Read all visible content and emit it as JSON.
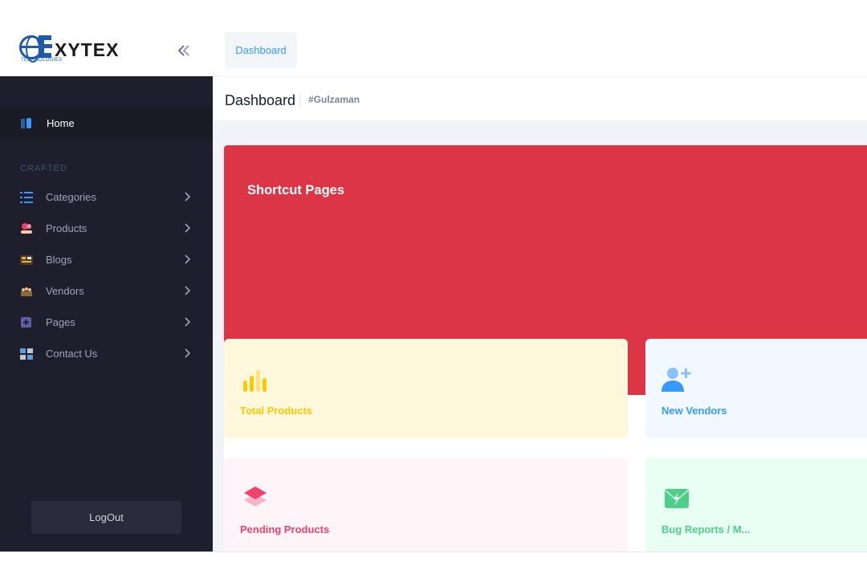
{
  "brand": {
    "logo_text": "XYTEX",
    "logo_subtext": "TECHNOLOGIES"
  },
  "header": {
    "tab_label": "Dashboard"
  },
  "subheader": {
    "title": "Dashboard",
    "user_tag": "#Gulzaman"
  },
  "sidebar": {
    "home_label": "Home",
    "section_title": "CRAFTED",
    "items": [
      {
        "label": "Categories",
        "icon": "list-icon"
      },
      {
        "label": "Products",
        "icon": "product-hand-icon"
      },
      {
        "label": "Blogs",
        "icon": "blog-icon"
      },
      {
        "label": "Vendors",
        "icon": "vendors-icon"
      },
      {
        "label": "Pages",
        "icon": "pages-plus-icon"
      },
      {
        "label": "Contact Us",
        "icon": "contact-icon"
      }
    ],
    "logout_label": "LogOut"
  },
  "dashboard": {
    "card_title": "Shortcut Pages",
    "tiles": [
      {
        "label": "Total Products",
        "color": "#ffc700",
        "icon": "bar-chart-icon"
      },
      {
        "label": "New Vendors",
        "color": "#3699ff",
        "icon": "add-user-icon"
      },
      {
        "label": "Pending Products",
        "color": "#f1416c",
        "icon": "layers-icon"
      },
      {
        "label": "Bug Reports / M...",
        "color": "#50cd89",
        "icon": "mail-flash-icon"
      }
    ]
  },
  "colors": {
    "sidebar_bg": "#1e1e2d",
    "primary": "#3699ff",
    "danger": "#dc3545",
    "warning_light": "#fff8dd",
    "primary_light": "#f1f8ff",
    "pink_light": "#fff5f8",
    "success_light": "#e8fff3"
  }
}
